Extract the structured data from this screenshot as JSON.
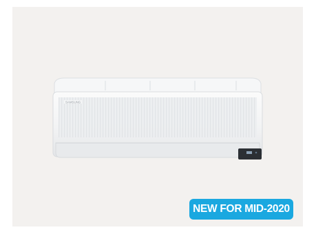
{
  "product": {
    "brand_logo_text": "SAMSUNG",
    "image_icon": "air-conditioner-image",
    "card_background": "#f3f1ef"
  },
  "badge": {
    "label": "NEW FOR MID-2020",
    "color": "#1aa8e0"
  }
}
